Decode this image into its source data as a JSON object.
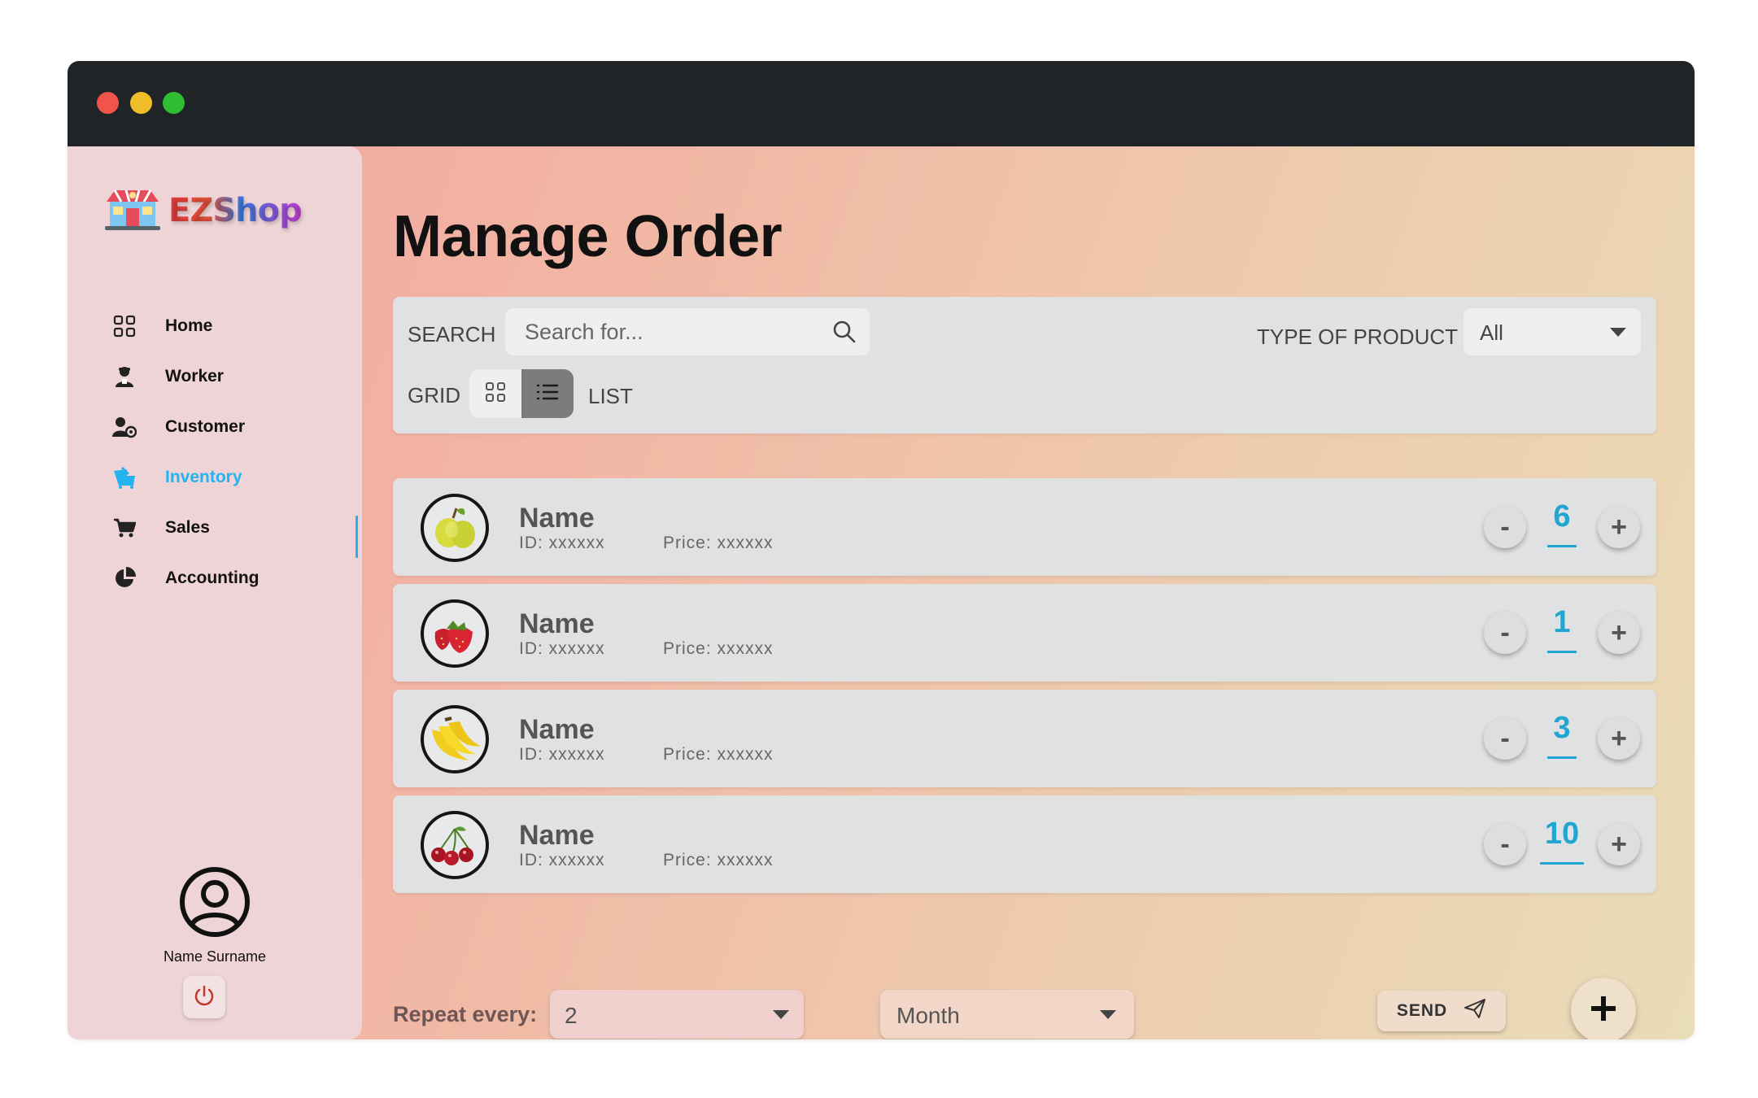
{
  "app": {
    "logo_text": "EZShop"
  },
  "sidebar": {
    "items": [
      {
        "label": "Home",
        "icon": "grid-icon"
      },
      {
        "label": "Worker",
        "icon": "worker-icon"
      },
      {
        "label": "Customer",
        "icon": "customer-icon"
      },
      {
        "label": "Inventory",
        "icon": "inventory-icon",
        "active": true
      },
      {
        "label": "Sales",
        "icon": "cart-icon"
      },
      {
        "label": "Accounting",
        "icon": "pie-chart-icon"
      }
    ],
    "user_name": "Name Surname"
  },
  "page": {
    "title": "Manage Order"
  },
  "filters": {
    "search_label": "SEARCH",
    "search_placeholder": "Search for...",
    "type_label": "TYPE OF PRODUCT",
    "type_value": "All",
    "grid_label": "GRID",
    "list_label": "LIST",
    "view_mode": "list"
  },
  "products": [
    {
      "name": "Name",
      "id": "ID: xxxxxx",
      "price": "Price: xxxxxx",
      "qty": "6",
      "image": "pear-icon"
    },
    {
      "name": "Name",
      "id": "ID: xxxxxx",
      "price": "Price: xxxxxx",
      "qty": "1",
      "image": "strawberry-icon"
    },
    {
      "name": "Name",
      "id": "ID: xxxxxx",
      "price": "Price: xxxxxx",
      "qty": "3",
      "image": "banana-icon"
    },
    {
      "name": "Name",
      "id": "ID: xxxxxx",
      "price": "Price: xxxxxx",
      "qty": "10",
      "image": "cherry-icon"
    }
  ],
  "controls": {
    "minus": "-",
    "plus": "+"
  },
  "footer": {
    "repeat_label": "Repeat every:",
    "repeat_count": "2",
    "repeat_period": "Month",
    "send_label": "SEND"
  },
  "colors": {
    "accent": "#22b3f0",
    "qty": "#23a5d2",
    "titlebar": "#212427",
    "sidebar": "#eed4d6"
  }
}
